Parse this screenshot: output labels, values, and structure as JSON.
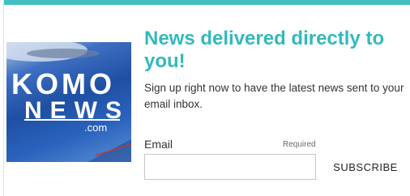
{
  "headline": "News delivered directly to you!",
  "subtext": "Sign up right now to have the latest news sent to your email inbox.",
  "logo": {
    "line1": "KOMO",
    "line2": "NEWS",
    "line3": ".com"
  },
  "form": {
    "email_label": "Email",
    "required_label": "Required",
    "email_value": "",
    "subscribe_label": "SUBSCRIBE"
  },
  "colors": {
    "accent": "#3fbfbf",
    "headline": "#33b9bd"
  }
}
